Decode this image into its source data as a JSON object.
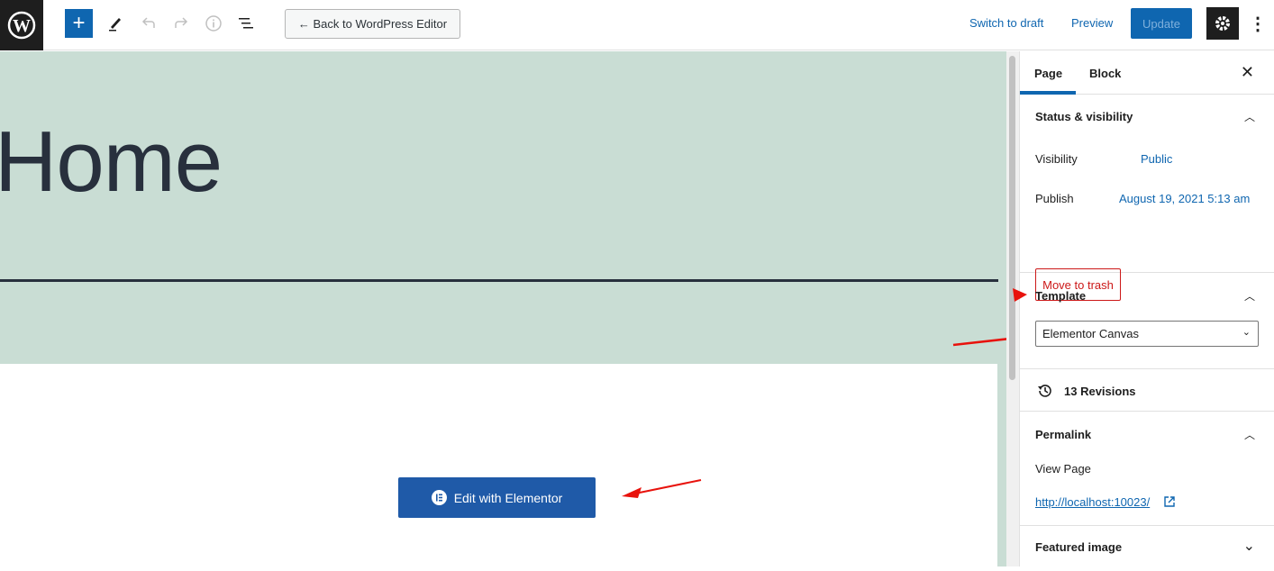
{
  "topbar": {
    "back_label": "← Back to WordPress Editor",
    "switch_draft": "Switch to draft",
    "preview": "Preview",
    "update": "Update",
    "add": "+",
    "more": "⋮"
  },
  "content": {
    "title": "Home",
    "edit_button": "Edit with Elementor"
  },
  "sidebar": {
    "tabs": [
      "Page",
      "Block"
    ],
    "close": "✕",
    "status": {
      "heading": "Status & visibility",
      "visibility_label": "Visibility",
      "visibility_value": "Public",
      "publish_label": "Publish",
      "publish_value": "August 19, 2021 5:13 am",
      "trash": "Move to trash"
    },
    "template": {
      "heading": "Template",
      "selected": "Elementor Canvas"
    },
    "revisions": "13 Revisions",
    "permalink": {
      "heading": "Permalink",
      "view_page": "View Page",
      "url": "http://localhost:10023/"
    },
    "featured": {
      "heading": "Featured image"
    }
  },
  "colors": {
    "accent": "#0f66b0",
    "hero_bg": "#c9ddd4",
    "danger": "#cc1818",
    "annotation_arrow": "#e8120c"
  }
}
